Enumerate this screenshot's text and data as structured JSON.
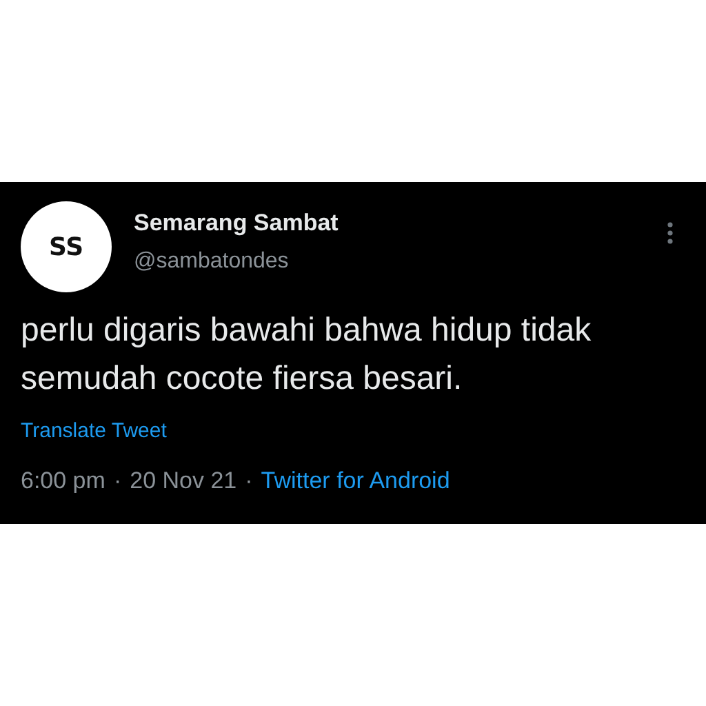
{
  "tweet": {
    "avatar_text": "SS",
    "name": "Semarang Sambat",
    "handle": "@sambatondes",
    "text": "perlu digaris bawahi bahwa hidup tidak semudah cocote fiersa besari.",
    "translate_link": "Translate Tweet",
    "time": "6:00 pm",
    "separator_1": "·",
    "date": "20 Nov 21",
    "separator_2": "·",
    "source": "Twitter for Android"
  }
}
